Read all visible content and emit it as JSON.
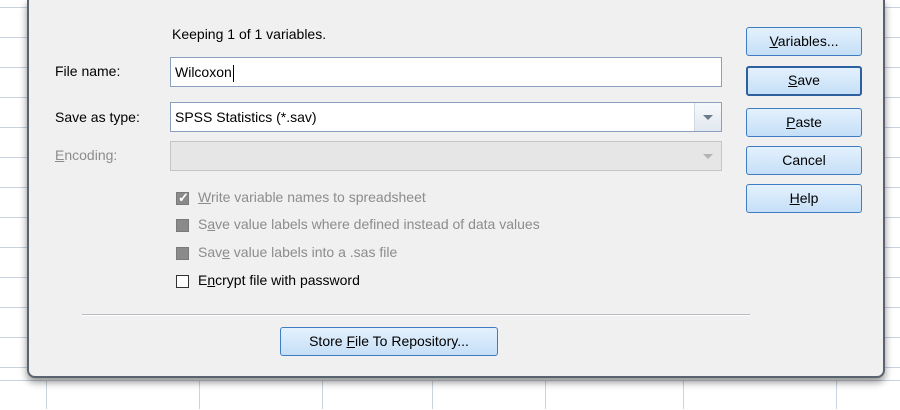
{
  "info": {
    "keeping": "Keeping 1 of 1 variables."
  },
  "file_name": {
    "label": "File name:",
    "value": "Wilcoxon"
  },
  "save_as_type": {
    "label": "Save as type:",
    "value": "SPSS Statistics (*.sav)"
  },
  "encoding": {
    "label_prefix": "",
    "label_mnemonic": "E",
    "label_rest": "ncoding:",
    "value": ""
  },
  "options": {
    "write_names": {
      "pre": "",
      "mn": "W",
      "post": "rite variable names to spreadsheet",
      "checked": true,
      "enabled": false
    },
    "save_value_labels": {
      "pre": "S",
      "mn": "a",
      "post": "ve value labels where defined instead of data values",
      "checked": false,
      "enabled": false
    },
    "save_sas": {
      "pre": "Sav",
      "mn": "e",
      "post": " value labels into a .sas file",
      "checked": false,
      "enabled": false
    },
    "encrypt": {
      "pre": "E",
      "mn": "n",
      "post": "crypt file with password",
      "checked": false,
      "enabled": true
    }
  },
  "buttons": {
    "variables": {
      "pre": "",
      "mn": "V",
      "post": "ariables..."
    },
    "save": {
      "pre": "",
      "mn": "S",
      "post": "ave"
    },
    "paste": {
      "pre": "",
      "mn": "P",
      "post": "aste"
    },
    "cancel": {
      "pre": "Cancel",
      "mn": "",
      "post": ""
    },
    "help": {
      "pre": "",
      "mn": "H",
      "post": "elp"
    },
    "store": {
      "pre": "Store ",
      "mn": "F",
      "post": "ile To Repository..."
    }
  },
  "colors": {
    "button_border": "#3f7cc4",
    "button_fill": "#c5dff7",
    "dialog_bg": "#f0f0f0"
  }
}
